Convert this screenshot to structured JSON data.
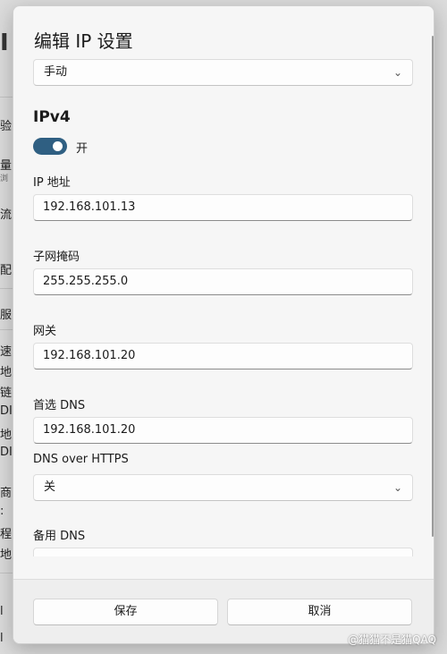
{
  "dialog": {
    "title": "编辑 IP 设置",
    "mode_value": "手动",
    "section_title": "IPv4",
    "toggle_label": "开",
    "toggle_on": true,
    "fields": {
      "ip_label": "IP 地址",
      "ip_value": "192.168.101.13",
      "subnet_label": "子网掩码",
      "subnet_value": "255.255.255.0",
      "gateway_label": "网关",
      "gateway_value": "192.168.101.20",
      "preferred_dns_label": "首选 DNS",
      "preferred_dns_value": "192.168.101.20",
      "dns_https_label": "DNS over HTTPS",
      "dns_https_value": "关",
      "alternate_dns_label": "备用 DNS",
      "alternate_dns_value": ""
    },
    "save_label": "保存",
    "cancel_label": "取消"
  },
  "background": {
    "items": [
      "I",
      "验",
      "量",
      "浏",
      "流",
      "配",
      "服",
      "速",
      "地",
      "链",
      "DI",
      "地",
      "DI",
      "商",
      ":",
      "程",
      "地",
      "l",
      "l"
    ]
  },
  "watermark": "@猫猫不是猫QAQ",
  "icons": {
    "chevron": "chevron-down-icon"
  },
  "colors": {
    "accent": "#2f5f82",
    "dialog_bg": "#f6f6f6"
  }
}
